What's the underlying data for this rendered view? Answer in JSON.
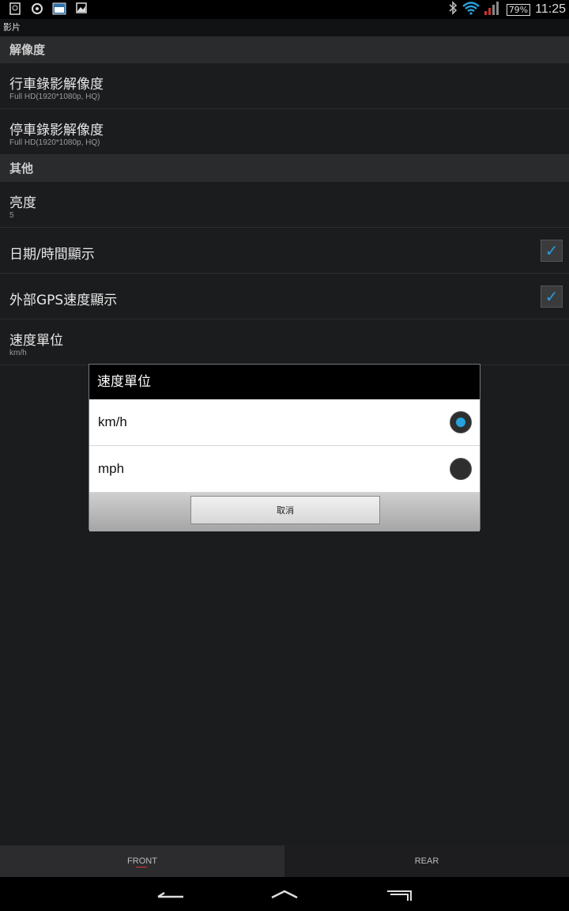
{
  "status_bar": {
    "battery": "79%",
    "time": "11:25"
  },
  "screen_title": "影片",
  "sections": {
    "resolution": "解像度",
    "other": "其他"
  },
  "settings": {
    "drive_res": {
      "title": "行車錄影解像度",
      "summary": "Full HD(1920*1080p, HQ)"
    },
    "park_res": {
      "title": "停車錄影解像度",
      "summary": "Full HD(1920*1080p, HQ)"
    },
    "brightness": {
      "title": "亮度",
      "summary": "5"
    },
    "datetime": {
      "title": "日期/時間顯示",
      "checked": true
    },
    "gps_speed": {
      "title": "外部GPS速度顯示",
      "checked": true
    },
    "speed_unit": {
      "title": "速度單位",
      "summary": "km/h"
    }
  },
  "dialog": {
    "title": "速度單位",
    "options": [
      {
        "label": "km/h",
        "selected": true
      },
      {
        "label": "mph",
        "selected": false
      }
    ],
    "cancel": "取消"
  },
  "tabs": {
    "front": "FRONT",
    "rear": "REAR"
  },
  "colors": {
    "accent": "#27a2dd",
    "background": "#1b1c1e"
  }
}
